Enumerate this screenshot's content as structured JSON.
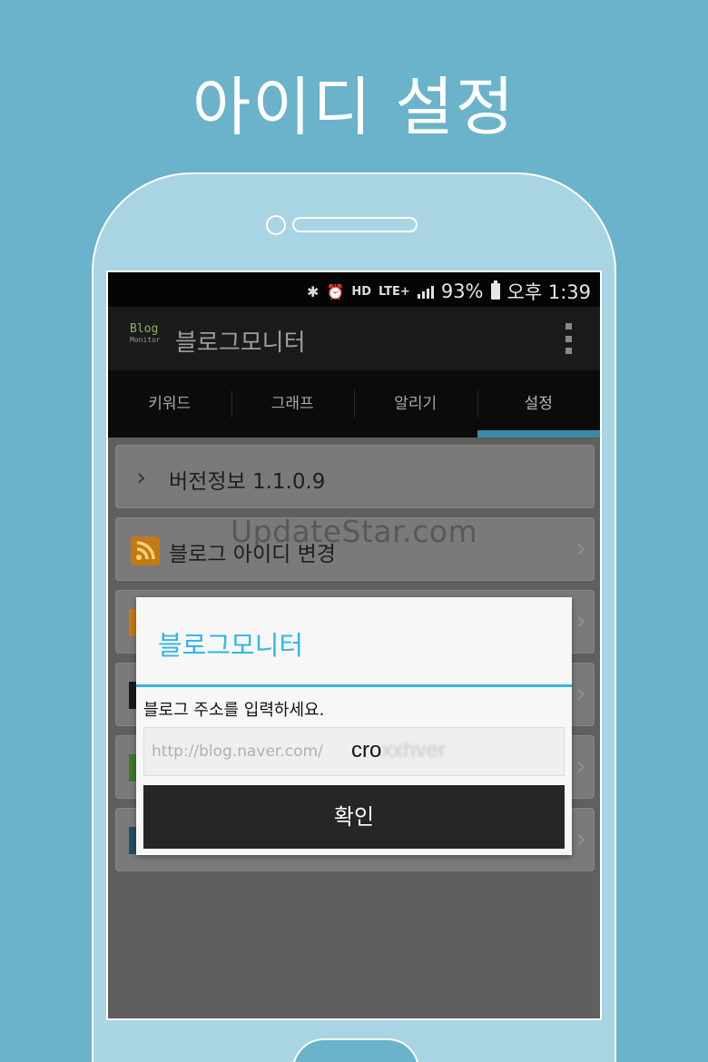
{
  "headline": "아이디 설정",
  "status_bar": {
    "bluetooth_icon": "bluetooth-icon",
    "alarm_icon": "alarm-icon",
    "hd_label": "HD",
    "lte_label": "LTE+",
    "battery_percent": "93%",
    "time": "오후 1:39"
  },
  "app_bar": {
    "logo_line1": "Blog",
    "logo_line2": "Monitor",
    "title": "블로그모니터"
  },
  "tabs": [
    {
      "label": "키워드",
      "active": false
    },
    {
      "label": "그래프",
      "active": false
    },
    {
      "label": "알리기",
      "active": false
    },
    {
      "label": "설정",
      "active": true
    }
  ],
  "settings": {
    "version_label": "버전정보 1.1.0.9",
    "change_id_label": "블로그 아이디 변경"
  },
  "watermark": "UpdateStar.com",
  "dialog": {
    "title": "블로그모니터",
    "message": "블로그 주소를 입력하세요.",
    "input_prefix": "http://blog.naver.com/",
    "input_value_visible": "cro",
    "input_value_obscured": "xxhver",
    "confirm_label": "확인"
  },
  "colors": {
    "background": "#6ab3ca",
    "accent": "#33b5e5",
    "tab_indicator": "#3a8aa8"
  }
}
